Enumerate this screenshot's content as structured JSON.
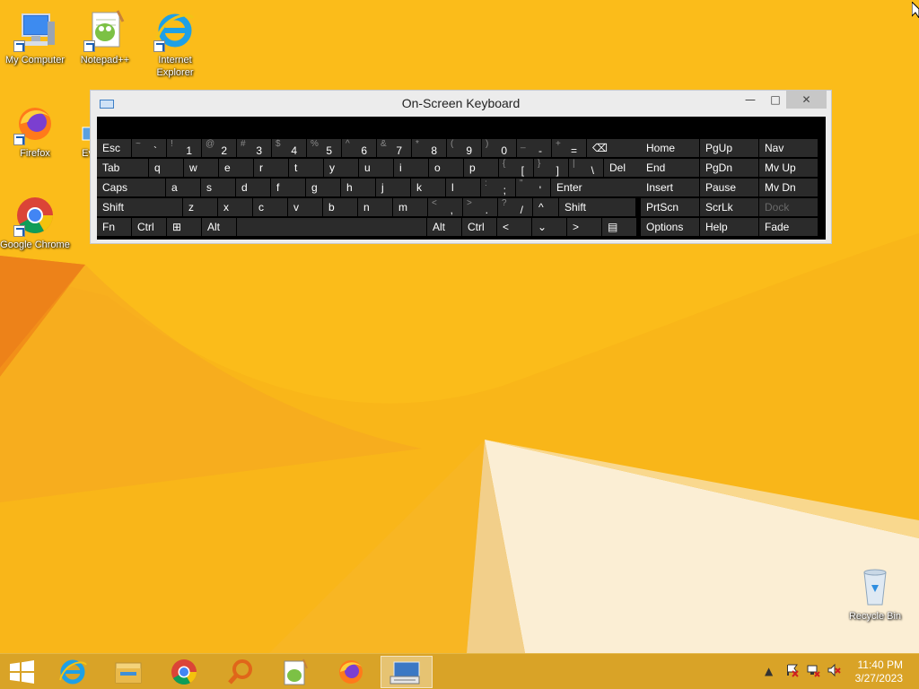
{
  "desktop": {
    "icons": [
      {
        "label": "My Computer",
        "icon": "computer-icon"
      },
      {
        "label": "Notepad++",
        "icon": "notepadpp-icon"
      },
      {
        "label": "Internet Explorer",
        "icon": "ie-icon"
      },
      {
        "label": "Firefox",
        "icon": "firefox-icon"
      },
      {
        "label": "Ev",
        "icon": "app-icon"
      },
      {
        "label": "Google Chrome",
        "icon": "chrome-icon"
      },
      {
        "label": "Recycle Bin",
        "icon": "recycle-bin-icon"
      }
    ]
  },
  "osk": {
    "title": "On-Screen Keyboard",
    "rows": [
      [
        {
          "main": "Esc"
        },
        {
          "shift": "~",
          "lower": "`"
        },
        {
          "shift": "!",
          "lower": "1"
        },
        {
          "shift": "@",
          "lower": "2"
        },
        {
          "shift": "#",
          "lower": "3"
        },
        {
          "shift": "$",
          "lower": "4"
        },
        {
          "shift": "%",
          "lower": "5"
        },
        {
          "shift": "^",
          "lower": "6"
        },
        {
          "shift": "&",
          "lower": "7"
        },
        {
          "shift": "*",
          "lower": "8"
        },
        {
          "shift": "(",
          "lower": "9"
        },
        {
          "shift": ")",
          "lower": "0"
        },
        {
          "shift": "_",
          "lower": "-"
        },
        {
          "shift": "+",
          "lower": "="
        },
        {
          "main": "⌫"
        },
        {
          "main": "Home"
        },
        {
          "main": "PgUp"
        },
        {
          "main": "Nav"
        }
      ],
      [
        {
          "main": "Tab"
        },
        {
          "main": "q"
        },
        {
          "main": "w"
        },
        {
          "main": "e"
        },
        {
          "main": "r"
        },
        {
          "main": "t"
        },
        {
          "main": "y"
        },
        {
          "main": "u"
        },
        {
          "main": "i"
        },
        {
          "main": "o"
        },
        {
          "main": "p"
        },
        {
          "shift": "{",
          "lower": "["
        },
        {
          "shift": "}",
          "lower": "]"
        },
        {
          "shift": "|",
          "lower": "\\"
        },
        {
          "main": "Del"
        },
        {
          "main": "End"
        },
        {
          "main": "PgDn"
        },
        {
          "main": "Mv Up"
        }
      ],
      [
        {
          "main": "Caps"
        },
        {
          "main": "a"
        },
        {
          "main": "s"
        },
        {
          "main": "d"
        },
        {
          "main": "f"
        },
        {
          "main": "g"
        },
        {
          "main": "h"
        },
        {
          "main": "j"
        },
        {
          "main": "k"
        },
        {
          "main": "l"
        },
        {
          "shift": ":",
          "lower": ";"
        },
        {
          "shift": "\"",
          "lower": "'"
        },
        {
          "main": "Enter"
        },
        {
          "main": "Insert"
        },
        {
          "main": "Pause"
        },
        {
          "main": "Mv Dn"
        }
      ],
      [
        {
          "main": "Shift"
        },
        {
          "main": "z"
        },
        {
          "main": "x"
        },
        {
          "main": "c"
        },
        {
          "main": "v"
        },
        {
          "main": "b"
        },
        {
          "main": "n"
        },
        {
          "main": "m"
        },
        {
          "shift": "<",
          "lower": ","
        },
        {
          "shift": ">",
          "lower": "."
        },
        {
          "shift": "?",
          "lower": "/"
        },
        {
          "main": "^"
        },
        {
          "main": "Shift"
        },
        {
          "main": "PrtScn"
        },
        {
          "main": "ScrLk"
        },
        {
          "main": "Dock",
          "dim": true
        }
      ],
      [
        {
          "main": "Fn"
        },
        {
          "main": "Ctrl"
        },
        {
          "main": "⊞"
        },
        {
          "main": "Alt"
        },
        {
          "main": ""
        },
        {
          "main": "Alt"
        },
        {
          "main": "Ctrl"
        },
        {
          "main": "<"
        },
        {
          "main": "⌄"
        },
        {
          "main": ">"
        },
        {
          "main": "▤"
        },
        {
          "main": "Options"
        },
        {
          "main": "Help"
        },
        {
          "main": "Fade"
        }
      ]
    ]
  },
  "taskbar": {
    "items": [
      "start-icon",
      "ie-icon",
      "file-explorer-icon",
      "chrome-icon",
      "search-icon",
      "notepadpp-icon",
      "firefox-icon",
      "on-screen-keyboard-icon"
    ],
    "tray": [
      "show-hidden-icons-icon",
      "action-center-icon",
      "network-icon",
      "volume-muted-icon"
    ],
    "time": "11:40 PM",
    "date": "3/27/2023"
  }
}
